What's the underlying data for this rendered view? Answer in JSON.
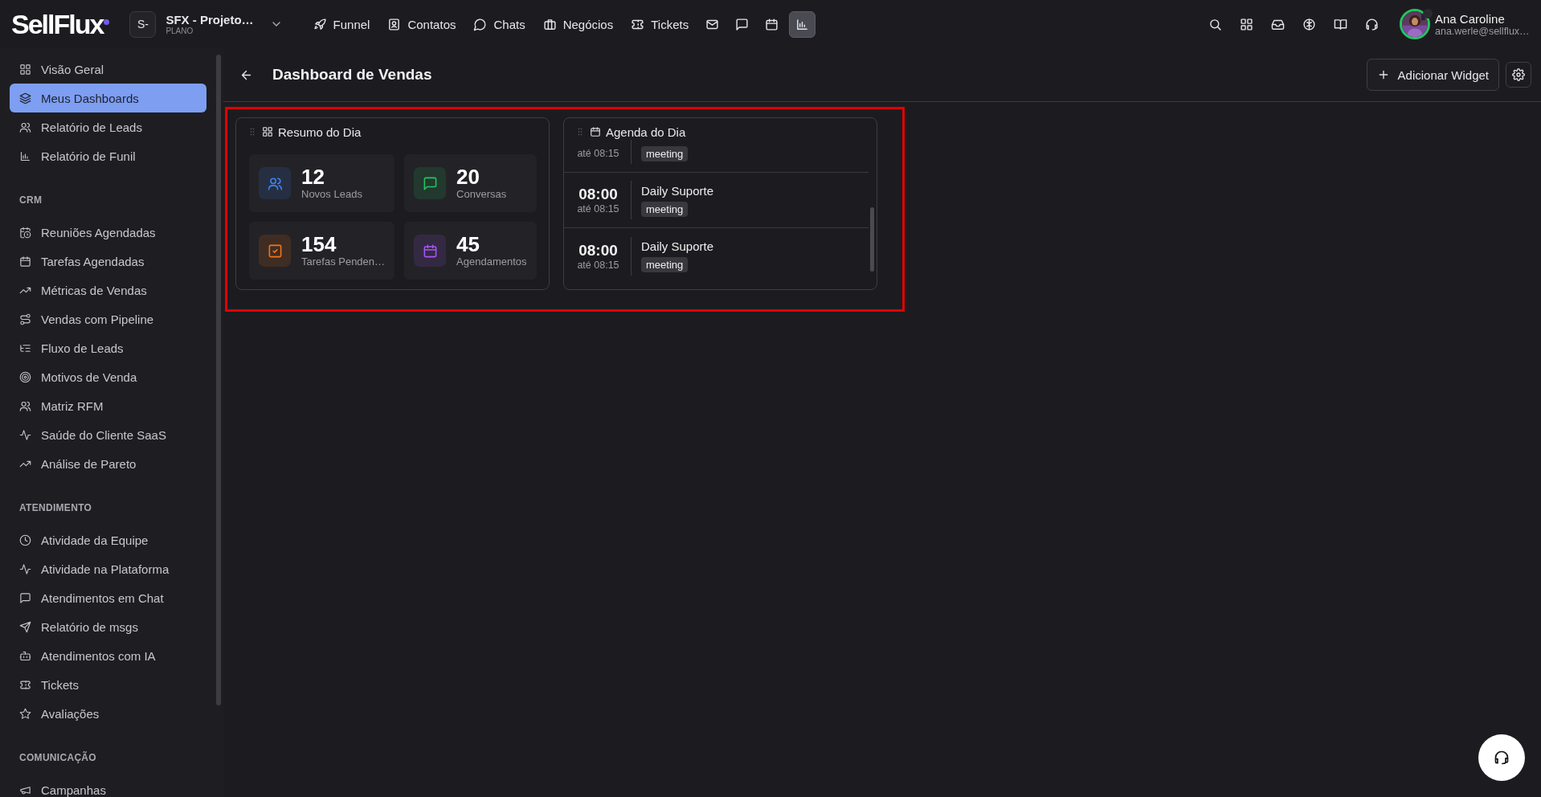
{
  "brand": {
    "logo": "SellFlux"
  },
  "workspace": {
    "badge": "S-",
    "name": "SFX - Projeto…",
    "plan": "PLANO"
  },
  "nav": [
    {
      "label": "Funnel",
      "selected": false
    },
    {
      "label": "Contatos",
      "selected": false
    },
    {
      "label": "Chats",
      "selected": false
    },
    {
      "label": "Negócios",
      "selected": false
    },
    {
      "label": "Tickets",
      "selected": false
    },
    {
      "selected": false
    },
    {
      "selected": false
    },
    {
      "selected": false
    },
    {
      "selected": true
    }
  ],
  "user": {
    "name": "Ana Caroline",
    "email": "ana.werle@sellflux…",
    "online": false
  },
  "sidebar": {
    "sections": [
      {
        "items": [
          {
            "label": "Visão Geral",
            "selected": false
          },
          {
            "label": "Meus Dashboards",
            "selected": true
          },
          {
            "label": "Relatório de Leads",
            "selected": false
          },
          {
            "label": "Relatório de Funil",
            "selected": false
          }
        ]
      },
      {
        "heading": "CRM",
        "items": [
          {
            "label": "Reuniões Agendadas",
            "selected": false
          },
          {
            "label": "Tarefas Agendadas",
            "selected": false
          },
          {
            "label": "Métricas de Vendas",
            "selected": false
          },
          {
            "label": "Vendas com Pipeline",
            "selected": false
          },
          {
            "label": "Fluxo de Leads",
            "selected": false
          },
          {
            "label": "Motivos de Venda",
            "selected": false
          },
          {
            "label": "Matriz RFM",
            "selected": false
          },
          {
            "label": "Saúde do Cliente SaaS",
            "selected": false
          },
          {
            "label": "Análise de Pareto",
            "selected": false
          }
        ]
      },
      {
        "heading": "ATENDIMENTO",
        "items": [
          {
            "label": "Atividade da Equipe",
            "selected": false
          },
          {
            "label": "Atividade na Plataforma",
            "selected": false
          },
          {
            "label": "Atendimentos em Chat",
            "selected": false
          },
          {
            "label": "Relatório de msgs",
            "selected": false
          },
          {
            "label": "Atendimentos com IA",
            "selected": false
          },
          {
            "label": "Tickets",
            "selected": false
          },
          {
            "label": "Avaliações",
            "selected": false
          }
        ]
      },
      {
        "heading": "COMUNICAÇÃO",
        "items": [
          {
            "label": "Campanhas",
            "selected": false
          }
        ]
      }
    ]
  },
  "page": {
    "title": "Dashboard de Vendas",
    "add_button": "Adicionar Widget"
  },
  "widgets": {
    "highlighted": true,
    "summary": {
      "title": "Resumo do Dia",
      "stats": [
        {
          "value": "12",
          "label": "Novos Leads",
          "color": "#3b82f6"
        },
        {
          "value": "20",
          "label": "Conversas",
          "color": "#22c55e"
        },
        {
          "value": "154",
          "label": "Tarefas Penden…",
          "color": "#f97316"
        },
        {
          "value": "45",
          "label": "Agendamentos",
          "color": "#a855f7"
        }
      ]
    },
    "agenda": {
      "title": "Agenda do Dia",
      "events": [
        {
          "until": "até 08:15",
          "tag": "meeting"
        },
        {
          "time": "08:00",
          "until": "até 08:15",
          "title": "Daily Suporte",
          "tag": "meeting"
        },
        {
          "time": "08:00",
          "until": "até 08:15",
          "title": "Daily Suporte",
          "tag": "meeting"
        }
      ]
    }
  }
}
